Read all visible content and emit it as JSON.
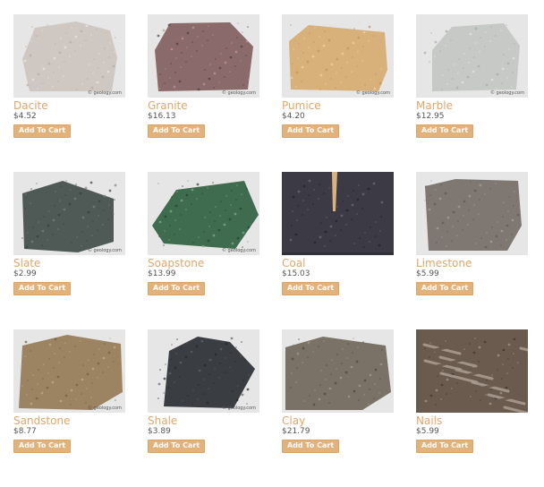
{
  "products": [
    {
      "name": "Dacite",
      "price": "$4.52",
      "button": "Add To Cart",
      "image": "dacite-rock-photo",
      "watermark": "© geology.com",
      "colors": [
        "#cfc7c2",
        "#b7ada7",
        "#ebe6e2"
      ]
    },
    {
      "name": "Granite",
      "price": "$16.13",
      "button": "Add To Cart",
      "image": "granite-rock-photo",
      "watermark": "© geology.com",
      "colors": [
        "#8a6a6a",
        "#4d4042",
        "#c69591"
      ]
    },
    {
      "name": "Pumice",
      "price": "$4.20",
      "button": "Add To Cart",
      "image": "pumice-rock-photo",
      "watermark": "© geology.com",
      "colors": [
        "#d8b07a",
        "#bf935c",
        "#efd3a6"
      ]
    },
    {
      "name": "Marble",
      "price": "$12.95",
      "button": "Add To Cart",
      "image": "marble-rock-photo",
      "watermark": "© geology.com",
      "colors": [
        "#c7c9c6",
        "#a7aaa7",
        "#e6e7e4"
      ]
    },
    {
      "name": "Slate",
      "price": "$2.99",
      "button": "Add To Cart",
      "image": "slate-rock-photo",
      "watermark": "© geology.com",
      "colors": [
        "#4f5a56",
        "#353f3c",
        "#77827e"
      ]
    },
    {
      "name": "Soapstone",
      "price": "$13.99",
      "button": "Add To Cart",
      "image": "soapstone-rock-photo",
      "watermark": "© geology.com",
      "colors": [
        "#3f6b4e",
        "#244133",
        "#86ad92"
      ]
    },
    {
      "name": "Coal",
      "price": "$15.03",
      "button": "Add To Cart",
      "image": "coal-rock-photo",
      "watermark": "",
      "colors": [
        "#3c3b45",
        "#1f1f26",
        "#6e6d78"
      ]
    },
    {
      "name": "Limestone",
      "price": "$5.99",
      "button": "Add To Cart",
      "image": "limestone-rock-photo",
      "watermark": "",
      "colors": [
        "#7f7772",
        "#5e5754",
        "#a9a19b"
      ]
    },
    {
      "name": "Sandstone",
      "price": "$8.77",
      "button": "Add To Cart",
      "image": "sandstone-rock-photo",
      "watermark": "© geology.com",
      "colors": [
        "#9c8462",
        "#6f5c44",
        "#c4ad88"
      ]
    },
    {
      "name": "Shale",
      "price": "$3.89",
      "button": "Add To Cart",
      "image": "shale-rock-photo",
      "watermark": "© geology.com",
      "colors": [
        "#3a3d42",
        "#23262b",
        "#5f646b"
      ]
    },
    {
      "name": "Clay",
      "price": "$21.79",
      "button": "Add To Cart",
      "image": "clay-rock-photo",
      "watermark": "",
      "colors": [
        "#7a7266",
        "#4a433b",
        "#a69d8f"
      ]
    },
    {
      "name": "Nails",
      "price": "$5.99",
      "button": "Add To Cart",
      "image": "nails-photo",
      "watermark": "",
      "colors": [
        "#6b5b4f",
        "#3a322d",
        "#a79a8e"
      ]
    }
  ]
}
